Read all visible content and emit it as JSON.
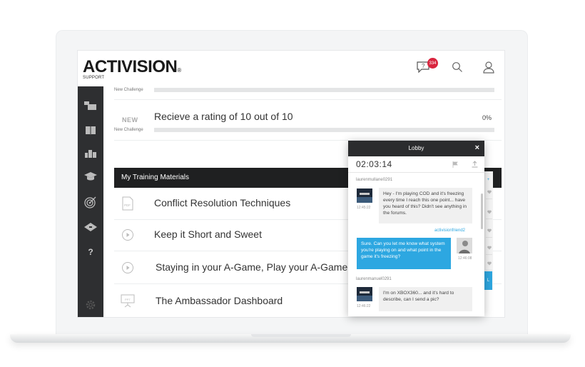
{
  "brand": {
    "logo_text": "ACTIVISION",
    "logo_reg": "®",
    "logo_sub": "SUPPORT"
  },
  "header": {
    "notification_count": "334",
    "icons": [
      "question-chat-icon",
      "search-icon",
      "user-icon"
    ]
  },
  "sidebar": {
    "icons": [
      "chat-bubbles-icon",
      "book-icon",
      "stats-bars-icon",
      "graduation-cap-icon",
      "target-icon",
      "diploma-icon",
      "help-icon",
      "settings-gear-icon"
    ],
    "help_label": "?"
  },
  "challenges": [
    {
      "tag": "",
      "label": "New Challenge",
      "title": "",
      "percent": ""
    },
    {
      "tag": "NEW",
      "label": "New Challenge",
      "title": "Recieve a rating of 10 out of 10",
      "percent": "0%"
    }
  ],
  "training": {
    "section_title": "My Training Materials",
    "items": [
      {
        "title": "Conflict Resolution Techniques",
        "icon": "pdf-file-icon",
        "icon_text": "PDF"
      },
      {
        "title": "Keep it Short and Sweet",
        "icon": "play-video-icon",
        "icon_text": ""
      },
      {
        "title": "Staying in your A-Game, Play your A-Game",
        "icon": "play-video-icon",
        "icon_text": ""
      },
      {
        "title": "The Ambassador Dashboard",
        "icon": "presentation-icon",
        "icon_text": "PPT"
      }
    ]
  },
  "chat": {
    "title": "Lobby",
    "close": "×",
    "timer": "02:03:14",
    "messages": [
      {
        "user": "laurenmullane0291",
        "time": "12:45:22",
        "text": "Hey - I'm playing COD and it's freezing every time I reach this one point... have you heard of this? Didn't see anything in the forums.",
        "direction": "incoming"
      },
      {
        "user": "activisionfriend2",
        "time": "12:46:08",
        "text": "Sure. Can you let me know what system you're playing on and what point in the game it's freezing?",
        "direction": "outgoing"
      },
      {
        "user": "laurenmanuel0291",
        "time": "12:46:22",
        "text": "I'm on XBOX360... and it's hard to describe, can I send a pic?",
        "direction": "incoming"
      }
    ]
  },
  "peek": {
    "top_glyph": "+",
    "blue_letter": "L"
  },
  "colors": {
    "accent_blue": "#2da7e1",
    "badge_red": "#d9253f",
    "sidebar_dark": "#2e2f31",
    "section_dark": "#1f2021"
  }
}
